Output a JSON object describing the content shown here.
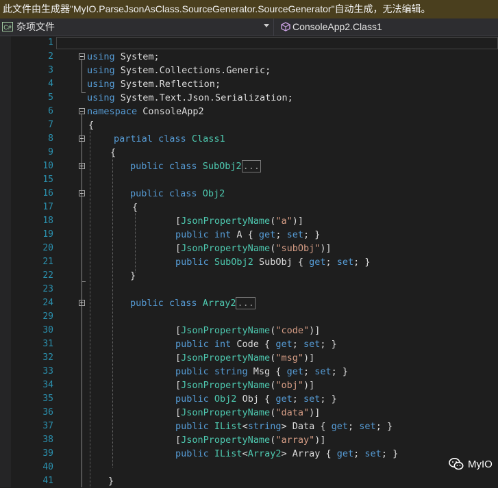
{
  "warning_bar": {
    "text": "此文件由生成器\"MyIO.ParseJsonAsClass.SourceGenerator.SourceGenerator\"自动生成，无法编辑。"
  },
  "nav": {
    "project_icon_text": "C#",
    "project": "杂项文件",
    "class": "ConsoleApp2.Class1",
    "icons": {
      "project": "csharp-file-icon",
      "class": "class-icon",
      "dropdown": "chevron-down-icon"
    }
  },
  "editor": {
    "line_numbers": [
      "1",
      "2",
      "3",
      "4",
      "5",
      "6",
      "7",
      "8",
      "9",
      "10",
      "15",
      "16",
      "17",
      "18",
      "19",
      "20",
      "21",
      "22",
      "23",
      "24",
      "29",
      "30",
      "31",
      "32",
      "33",
      "34",
      "35",
      "36",
      "37",
      "38",
      "39",
      "40",
      "41"
    ],
    "collapsed_marker": "..."
  },
  "watermark": {
    "text": "MyIO",
    "icon": "wechat-icon"
  },
  "colors": {
    "keyword": "#569cd6",
    "type": "#4ec9b0",
    "string": "#d69d85",
    "line_number": "#2b91af",
    "background": "#1e1e1e",
    "warning_bar": "#4a3f1e"
  }
}
